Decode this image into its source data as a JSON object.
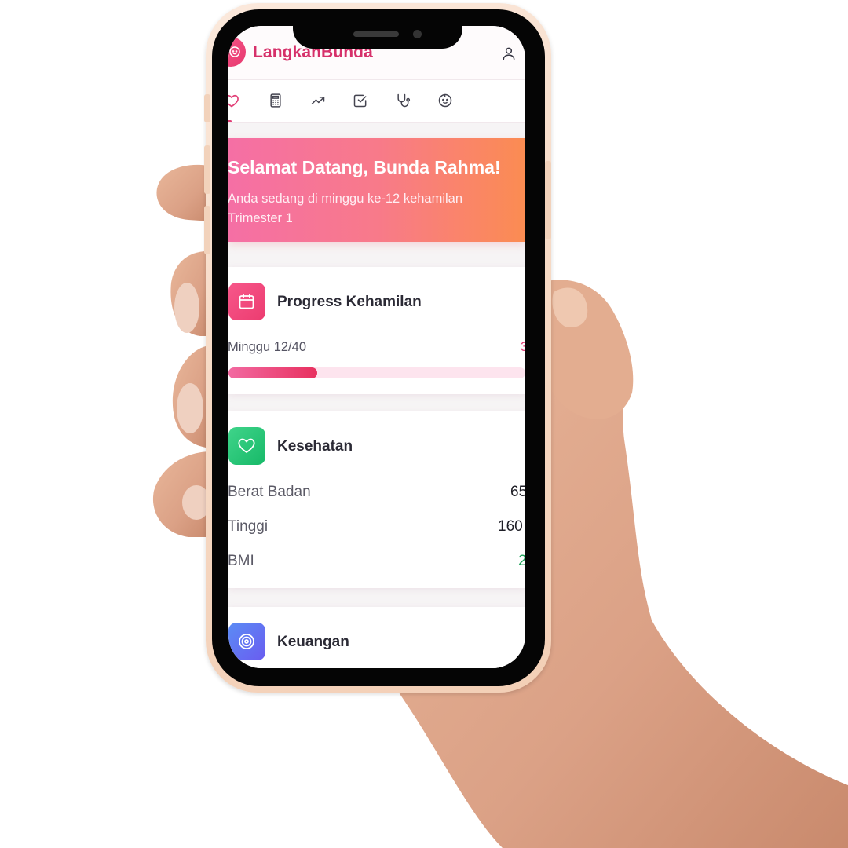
{
  "app": {
    "brand": "LangkanBunda",
    "accent_color": "#d6306a",
    "header_icons": [
      "baby-face-icon",
      "user-icon"
    ]
  },
  "tabs": [
    {
      "name": "home",
      "icon": "heart-icon",
      "active": true
    },
    {
      "name": "calculator",
      "icon": "calculator-icon",
      "active": false
    },
    {
      "name": "growth",
      "icon": "trending-up-icon",
      "active": false
    },
    {
      "name": "checklist",
      "icon": "check-square-icon",
      "active": false
    },
    {
      "name": "health-check",
      "icon": "stethoscope-icon",
      "active": false
    },
    {
      "name": "baby",
      "icon": "baby-face-icon",
      "active": false
    }
  ],
  "hero": {
    "title": "Selamat Datang, Bunda Rahma!",
    "subtitle": "Anda sedang di minggu ke-12 kehamilan",
    "trimester": "Trimester 1"
  },
  "progress_card": {
    "title": "Progress Kehamilan",
    "icon": "calendar-icon",
    "label": "Minggu 12/40",
    "value_text": "3",
    "progress_fraction": 0.3
  },
  "health_card": {
    "title": "Kesehatan",
    "icon": "heart-icon",
    "rows": [
      {
        "label": "Berat Badan",
        "value": "65",
        "value_color": "#1e1e26"
      },
      {
        "label": "Tinggi",
        "value": "160",
        "value_color": "#1e1e26"
      },
      {
        "label": "BMI",
        "value": "2",
        "value_color": "#1ea35a"
      }
    ]
  },
  "finance_card": {
    "title": "Keuangan",
    "icon": "target-icon"
  }
}
